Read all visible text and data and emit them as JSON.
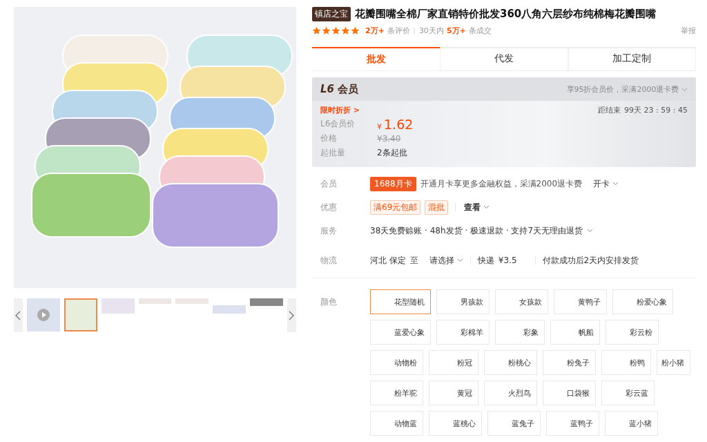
{
  "gallery": {
    "thumbnails": [
      {
        "kind": "video",
        "selected": false
      },
      {
        "kind": "image",
        "selected": true
      },
      {
        "kind": "image",
        "selected": false
      },
      {
        "kind": "image",
        "selected": false
      },
      {
        "kind": "image",
        "selected": false
      },
      {
        "kind": "image",
        "selected": false
      },
      {
        "kind": "image",
        "selected": false
      }
    ]
  },
  "product": {
    "badge": "镇店之宝",
    "title": "花瓣围嘴全棉厂家直销特价批发360八角六层纱布纯棉梅花瓣围嘴",
    "stars": 5,
    "review_count": "2万+",
    "review_label": "条评价",
    "period": "30天内",
    "deal_count": "5万+",
    "deal_label": "条成交",
    "report": "举报"
  },
  "tabs": [
    {
      "label": "批发",
      "selected": true
    },
    {
      "label": "代发",
      "selected": false
    },
    {
      "label": "加工定制",
      "selected": false
    }
  ],
  "member_box": {
    "level": "L6",
    "title": "会员",
    "note": "享95折会员价，采满2000退卡费",
    "promo": "限时折折 >",
    "countdown_label": "距结束",
    "countdown": "99天 23 : 59 : 45",
    "rows": [
      {
        "label": "L6会员价",
        "kind": "price",
        "currency": "¥",
        "value": "1.62"
      },
      {
        "label": "价格",
        "kind": "old",
        "value": "¥3.40"
      },
      {
        "label": "起批量",
        "kind": "plain",
        "value": "2条起批"
      }
    ]
  },
  "info": {
    "member": {
      "label": "会员",
      "tag": "1688月卡",
      "text": "开通月卡享更多金融权益，采满2000退卡费",
      "action": "开卡"
    },
    "discount": {
      "label": "优惠",
      "tags": [
        "满69元包邮",
        "混批"
      ],
      "action": "查看"
    },
    "service": {
      "label": "服务",
      "text": "38天免费赊账 · 48h发货 · 极速退款 · 支持7天无理由退货"
    },
    "logistics": {
      "label": "物流",
      "origin": "河北 保定",
      "to": "至",
      "destination": "请选择",
      "shipping": "快递",
      "fee": "¥3.5",
      "note": "付款成功后2天内安排发货"
    }
  },
  "colors": {
    "label": "颜色",
    "options": [
      [
        {
          "label": "花型随机",
          "selected": true
        },
        {
          "label": "男孩款",
          "selected": false
        },
        {
          "label": "女孩款",
          "selected": false
        },
        {
          "label": "黄鸭子",
          "selected": false
        },
        {
          "label": "粉爱心象",
          "selected": false
        }
      ],
      [
        {
          "label": "蓝爱心象",
          "selected": false
        },
        {
          "label": "彩棉羊",
          "selected": false
        },
        {
          "label": "彩象",
          "selected": false
        },
        {
          "label": "帆船",
          "selected": false
        },
        {
          "label": "彩云粉",
          "selected": false
        }
      ],
      [
        {
          "label": "动物粉",
          "selected": false
        },
        {
          "label": "粉冠",
          "selected": false
        },
        {
          "label": "粉桃心",
          "selected": false
        },
        {
          "label": "粉兔子",
          "selected": false
        },
        {
          "label": "粉鸭",
          "selected": false
        },
        {
          "label": "粉小猪",
          "selected": false
        }
      ],
      [
        {
          "label": "粉羊驼",
          "selected": false
        },
        {
          "label": "黄冠",
          "selected": false
        },
        {
          "label": "火烈鸟",
          "selected": false
        },
        {
          "label": "口袋猴",
          "selected": false
        },
        {
          "label": "彩云蓝",
          "selected": false
        }
      ],
      [
        {
          "label": "动物蓝",
          "selected": false
        },
        {
          "label": "蓝桃心",
          "selected": false
        },
        {
          "label": "蓝兔子",
          "selected": false
        },
        {
          "label": "蓝鸭子",
          "selected": false
        },
        {
          "label": "蓝小猪",
          "selected": false
        }
      ]
    ]
  }
}
